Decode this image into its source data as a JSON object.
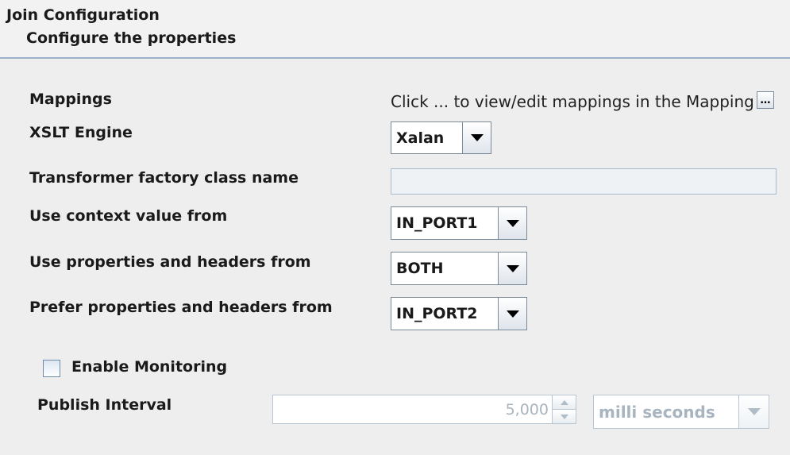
{
  "header": {
    "title": "Join Configuration",
    "subtitle": "Configure the properties"
  },
  "mappings": {
    "label": "Mappings",
    "info_text": "Click ... to view/edit mappings in the Mapping Editor",
    "button_label": "…"
  },
  "xslt_engine": {
    "label": "XSLT Engine",
    "value": "Xalan"
  },
  "transformer_factory": {
    "label": "Transformer factory class name",
    "value": ""
  },
  "context_value": {
    "label": "Use context value from",
    "value": "IN_PORT1"
  },
  "use_properties": {
    "label": "Use properties and headers from",
    "value": "BOTH"
  },
  "prefer_properties": {
    "label": "Prefer properties and headers from",
    "value": "IN_PORT2"
  },
  "monitoring": {
    "checkbox_label": "Enable Monitoring",
    "checked": false
  },
  "publish_interval": {
    "label": "Publish Interval",
    "value": "5,000",
    "units": "milli seconds"
  }
}
